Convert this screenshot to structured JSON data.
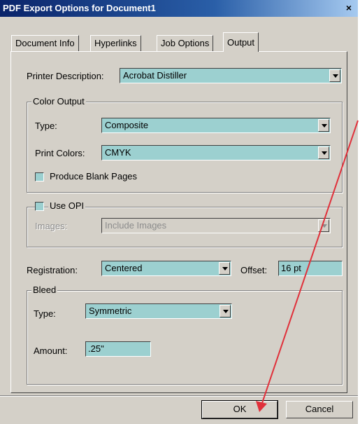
{
  "window": {
    "title": "PDF Export Options for Document1",
    "close_glyph": "×"
  },
  "tabs": [
    {
      "label": "Document Info"
    },
    {
      "label": "Hyperlinks"
    },
    {
      "label": "Job Options"
    },
    {
      "label": "Output",
      "active": true
    }
  ],
  "output": {
    "printer_description": {
      "label": "Printer Description:",
      "value": "Acrobat Distiller"
    },
    "color_output": {
      "title": "Color Output",
      "type": {
        "label": "Type:",
        "value": "Composite"
      },
      "print_colors": {
        "label": "Print Colors:",
        "value": "CMYK"
      },
      "blank_pages": {
        "label": "Produce Blank Pages",
        "checked": false
      }
    },
    "opi": {
      "use_opi": {
        "label": "Use OPI",
        "checked": false
      },
      "images": {
        "label": "Images:",
        "value": "Include Images",
        "disabled": true
      }
    },
    "registration": {
      "label": "Registration:",
      "value": "Centered"
    },
    "offset": {
      "label": "Offset:",
      "value": "16 pt"
    },
    "bleed": {
      "title": "Bleed",
      "type": {
        "label": "Type:",
        "value": "Symmetric"
      },
      "amount": {
        "label": "Amount:",
        "value": ".25\""
      }
    }
  },
  "buttons": {
    "ok": "OK",
    "cancel": "Cancel"
  },
  "colors": {
    "field_bg": "#9cd0d0",
    "dialog_bg": "#d4d0c8",
    "annotation_arrow": "#e0303a"
  }
}
